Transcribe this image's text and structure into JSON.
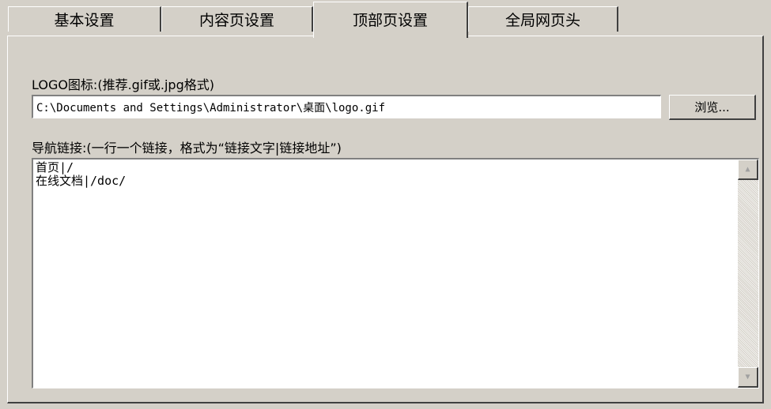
{
  "tabs": [
    {
      "label": "基本设置"
    },
    {
      "label": "内容页设置"
    },
    {
      "label": "顶部页设置"
    },
    {
      "label": "全局网页头"
    }
  ],
  "logo": {
    "label": "LOGO图标:(推荐.gif或.jpg格式)",
    "path": "C:\\Documents and Settings\\Administrator\\桌面\\logo.gif",
    "browse_label": "浏览..."
  },
  "nav": {
    "label": "导航链接:(一行一个链接，格式为“链接文字|链接地址”)",
    "content": "首页|/\n在线文档|/doc/"
  },
  "scrollbar": {
    "up_icon": "▲",
    "down_icon": "▼"
  }
}
